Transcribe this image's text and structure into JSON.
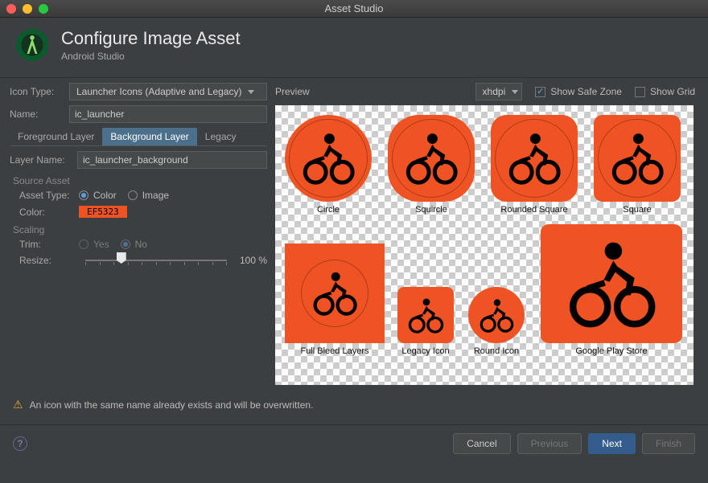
{
  "window": {
    "title": "Asset Studio"
  },
  "header": {
    "title": "Configure Image Asset",
    "subtitle": "Android Studio"
  },
  "left": {
    "icon_type_label": "Icon Type:",
    "icon_type_value": "Launcher Icons (Adaptive and Legacy)",
    "name_label": "Name:",
    "name_value": "ic_launcher",
    "tabs": {
      "foreground": "Foreground Layer",
      "background": "Background Layer",
      "legacy": "Legacy"
    },
    "layer_name_label": "Layer Name:",
    "layer_name_value": "ic_launcher_background",
    "source_asset_title": "Source Asset",
    "asset_type_label": "Asset Type:",
    "asset_type_color": "Color",
    "asset_type_image": "Image",
    "color_label": "Color:",
    "color_value": "EF5323",
    "scaling_title": "Scaling",
    "trim_label": "Trim:",
    "trim_yes": "Yes",
    "trim_no": "No",
    "resize_label": "Resize:",
    "resize_value": "100 %"
  },
  "preview": {
    "label": "Preview",
    "density": "xhdpi",
    "safe_zone_label": "Show Safe Zone",
    "grid_label": "Show Grid",
    "items": {
      "circle": "Circle",
      "squircle": "Squircle",
      "rsquare": "Rounded Square",
      "square": "Square",
      "full_bleed": "Full Bleed Layers",
      "legacy": "Legacy Icon",
      "round": "Round Icon",
      "play": "Google Play Store"
    }
  },
  "warning": "An icon with the same name already exists and will be overwritten.",
  "footer": {
    "cancel": "Cancel",
    "previous": "Previous",
    "next": "Next",
    "finish": "Finish"
  }
}
